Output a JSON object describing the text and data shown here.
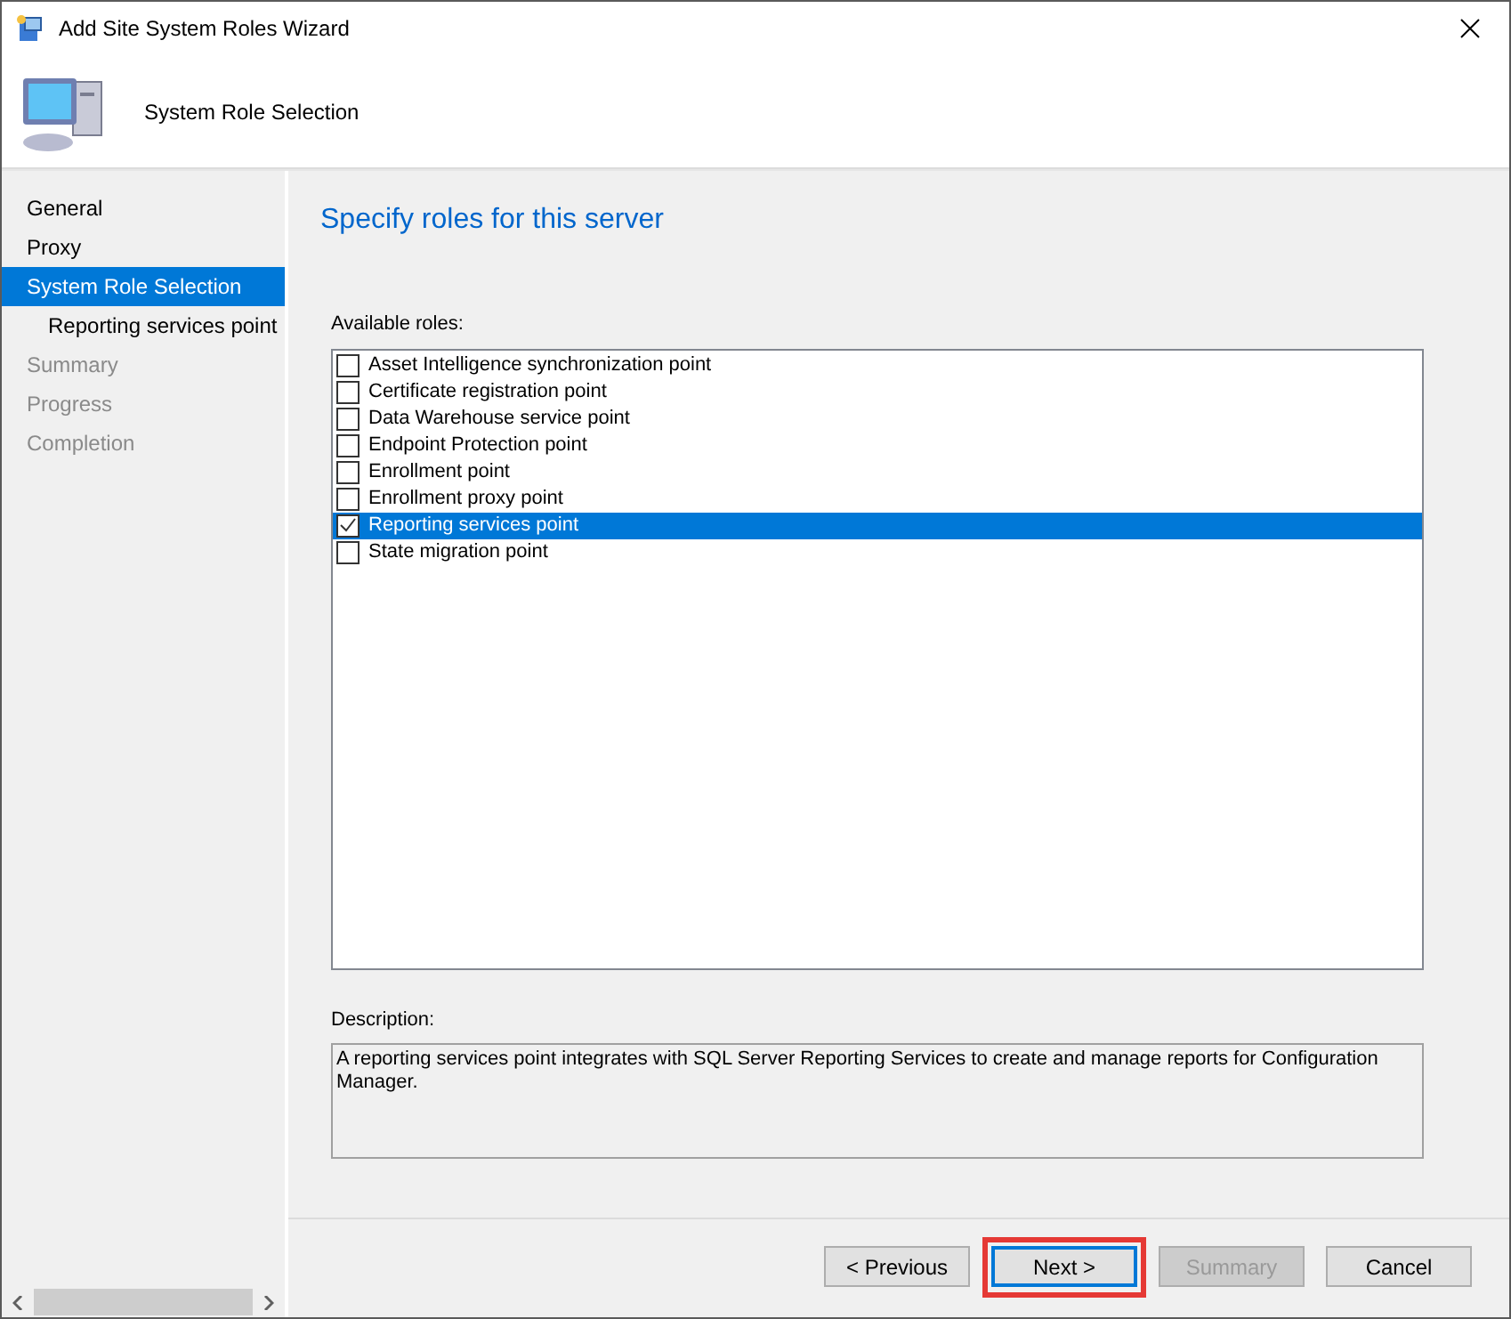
{
  "window": {
    "title": "Add Site System Roles Wizard"
  },
  "header": {
    "title": "System Role Selection"
  },
  "steps": [
    {
      "label": "General",
      "selected": false,
      "disabled": false
    },
    {
      "label": "Proxy",
      "selected": false,
      "disabled": false
    },
    {
      "label": "System Role Selection",
      "selected": true,
      "disabled": false,
      "children": [
        {
          "label": "Reporting services point",
          "selected": false,
          "disabled": false
        }
      ]
    },
    {
      "label": "Summary",
      "selected": false,
      "disabled": true
    },
    {
      "label": "Progress",
      "selected": false,
      "disabled": true
    },
    {
      "label": "Completion",
      "selected": false,
      "disabled": true
    }
  ],
  "page_title": "Specify roles for this server",
  "roles_label": "Available roles:",
  "roles": [
    {
      "label": "Asset Intelligence synchronization point",
      "checked": false,
      "selected": false
    },
    {
      "label": "Certificate registration point",
      "checked": false,
      "selected": false
    },
    {
      "label": "Data Warehouse service point",
      "checked": false,
      "selected": false
    },
    {
      "label": "Endpoint Protection point",
      "checked": false,
      "selected": false
    },
    {
      "label": "Enrollment point",
      "checked": false,
      "selected": false
    },
    {
      "label": "Enrollment proxy point",
      "checked": false,
      "selected": false
    },
    {
      "label": "Reporting services point",
      "checked": true,
      "selected": true
    },
    {
      "label": "State migration point",
      "checked": false,
      "selected": false
    }
  ],
  "description_label": "Description:",
  "description": "A reporting services point integrates with SQL Server Reporting Services to create and manage reports for Configuration Manager.",
  "buttons": [
    {
      "label": "< Previous",
      "disabled": false,
      "default": false,
      "highlighted": false
    },
    {
      "label": "Next >",
      "disabled": false,
      "default": true,
      "highlighted": true
    },
    {
      "label": "Summary",
      "disabled": true,
      "default": false,
      "highlighted": false
    },
    {
      "label": "Cancel",
      "disabled": false,
      "default": false,
      "highlighted": false
    }
  ]
}
